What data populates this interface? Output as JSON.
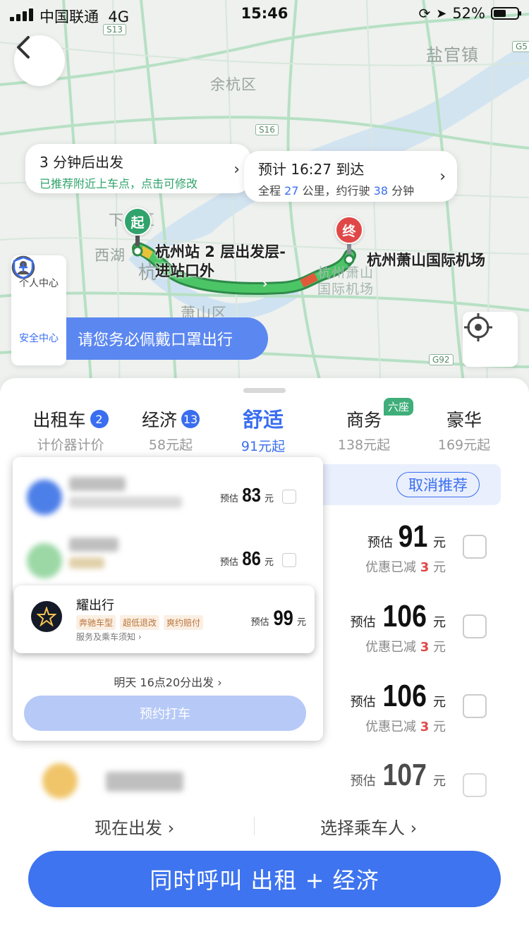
{
  "status_bar": {
    "carrier": "中国联通",
    "network": "4G",
    "time": "15:46",
    "battery": "52%"
  },
  "map": {
    "labels": {
      "yanguan": "盐官镇",
      "yuhang": "余杭区",
      "xicheng": "下城区",
      "xihu": "西湖",
      "hang": "杭",
      "xiaoshan": "萧山区",
      "airport_map": "杭州萧山\n国际机场"
    },
    "roads": {
      "s13": "S13",
      "s16": "S16",
      "g92": "G92",
      "g5": "G5"
    },
    "depart_bubble": {
      "title": "3 分钟后出发",
      "hint": "已推荐附近上车点，点击可修改"
    },
    "arrive_bubble": {
      "title": "预计 16:27 到达",
      "prefix": "全程 ",
      "distance": "27",
      "mid": " 公里，约行驶 ",
      "duration": "38",
      "suffix": " 分钟"
    },
    "start_pin": "起",
    "end_pin": "终",
    "start_label": "杭州站 2 层出发层-\n进站口外",
    "end_label": "杭州萧山国际机场",
    "personal_center": "个人中心",
    "safety_center": "安全中心",
    "mask_tip": "请您务必佩戴口罩出行"
  },
  "tabs": [
    {
      "name": "出租车",
      "badge": "2",
      "sub": "计价器计价"
    },
    {
      "name": "经济",
      "badge": "13",
      "sub": "58元起"
    },
    {
      "name": "舒适",
      "sub": "91元起"
    },
    {
      "name": "商务",
      "sub": "138元起",
      "tag": "六座"
    },
    {
      "name": "豪华",
      "sub": "169元起"
    }
  ],
  "cancel_recommend": "取消推荐",
  "price_rows": [
    {
      "label": "预估",
      "value": "91",
      "unit": "元",
      "disc_prefix": "优惠已减 ",
      "disc": "3",
      "disc_unit": " 元"
    },
    {
      "label": "预估",
      "value": "106",
      "unit": "元",
      "disc_prefix": "优惠已减 ",
      "disc": "3",
      "disc_unit": " 元"
    },
    {
      "label": "预估",
      "value": "106",
      "unit": "元",
      "disc_prefix": "优惠已减 ",
      "disc": "3",
      "disc_unit": " 元"
    },
    {
      "label": "预估",
      "value": "107",
      "unit": "元"
    }
  ],
  "float_card": {
    "rows": [
      {
        "label": "预估",
        "value": "83",
        "unit": "元"
      },
      {
        "label": "预估",
        "value": "86",
        "unit": "元"
      }
    ],
    "yao": {
      "name": "耀出行",
      "tags": [
        "奔驰车型",
        "超低退改",
        "爽约赔付"
      ],
      "sub": "服务及乘车须知 ›",
      "label": "预估",
      "value": "99",
      "unit": "元"
    },
    "tomorrow": "明天  16点20分出发  ›",
    "book": "预约打车"
  },
  "now_depart": "现在出发 ›",
  "choose_passenger": "选择乘车人 ›",
  "call_button": "同时呼叫 出租 + 经济",
  "colors": {
    "accent": "#3e74ef",
    "green": "#2fa36b",
    "red": "#e04848"
  }
}
